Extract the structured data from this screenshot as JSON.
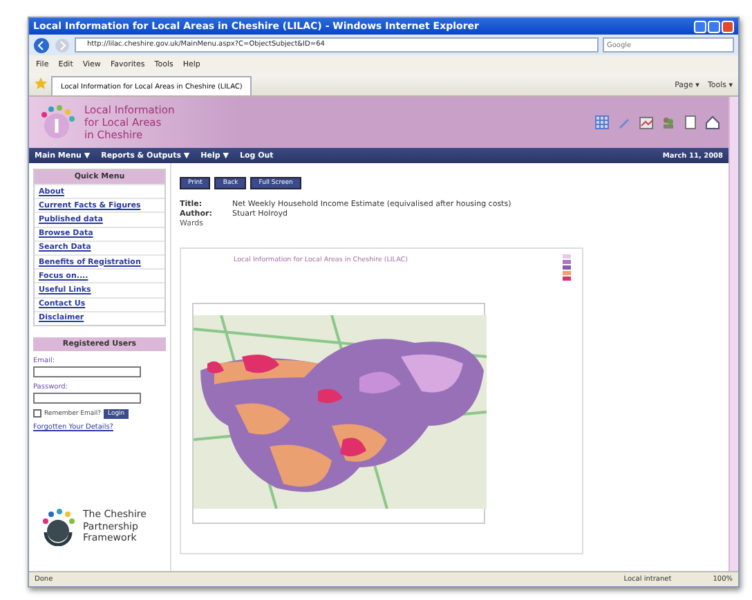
{
  "window": {
    "title": "Local Information for Local Areas in Cheshire (LILAC) - Windows Internet Explorer"
  },
  "address_bar": {
    "url": "http://lilac.cheshire.gov.uk/MainMenu.aspx?C=ObjectSubject&ID=64",
    "search_placeholder": "Google"
  },
  "menu_bar": [
    "File",
    "Edit",
    "View",
    "Favorites",
    "Tools",
    "Help"
  ],
  "tabs": [
    {
      "label": "Local Information for Local Areas in Cheshire (LILAC)",
      "selected": true
    }
  ],
  "command_bar": [
    "Page ▾",
    "Tools ▾"
  ],
  "site_header": {
    "logo_lines": [
      "Local Information",
      "for Local Areas",
      "in Cheshire"
    ]
  },
  "nav_bar": {
    "items": [
      "Main Menu ▼",
      "Reports & Outputs ▼",
      "Help ▼",
      "Log Out"
    ],
    "date": "March 11, 2008"
  },
  "quick_menu": {
    "heading": "Quick Menu",
    "links": [
      "About",
      "Current Facts & Figures",
      "Published data",
      "Browse Data",
      "Search Data",
      "Benefits of Registration",
      "Focus on....",
      "Useful Links",
      "Contact Us",
      "Disclaimer"
    ]
  },
  "login": {
    "heading": "Registered Users",
    "email_label": "Email:",
    "password_label": "Password:",
    "remember_label": "Remember Email?",
    "remember_checked": false,
    "login_button": "Login",
    "forgot_link": "Forgotten Your Details?"
  },
  "partner_logo": {
    "lines": [
      "The Cheshire",
      "Partnership",
      "Framework"
    ]
  },
  "buttons": [
    "Print",
    "Back",
    "Full Screen"
  ],
  "report": {
    "title_label": "Title:",
    "title": "Net Weekly Household Income Estimate (equivalised after housing costs)",
    "author_label": "Author:",
    "author": "Stuart Holroyd",
    "geography": "Wards"
  },
  "map": {
    "heading": "Local Information for Local Areas in Cheshire (LILAC)"
  },
  "status_bar": {
    "status": "Done",
    "zone": "Local intranet",
    "zoom": "100%"
  }
}
